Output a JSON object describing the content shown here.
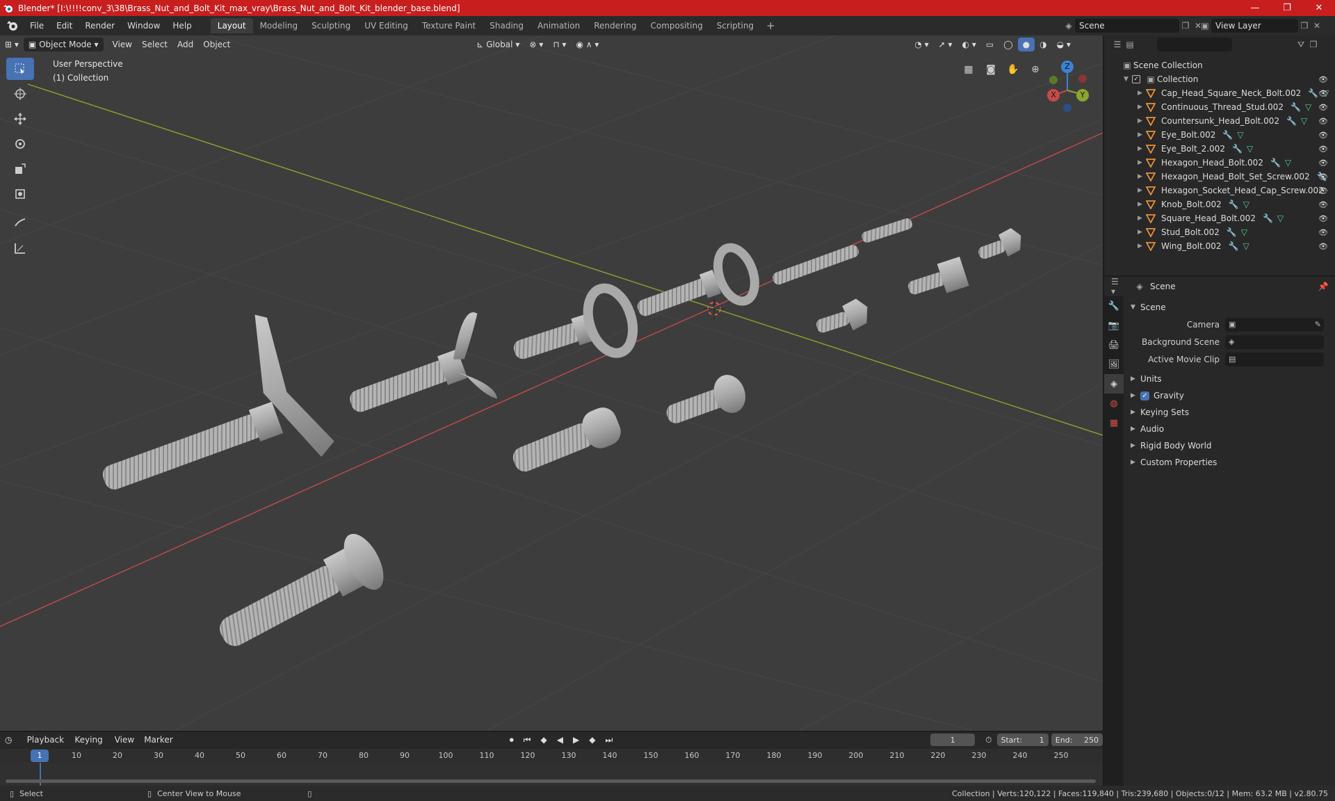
{
  "window": {
    "title": "Blender* [I:\\!!!!conv_3\\38\\Brass_Nut_and_Bolt_Kit_max_vray\\Brass_Nut_and_Bolt_Kit_blender_base.blend]",
    "controls": [
      "—",
      "❐",
      "✕"
    ]
  },
  "menubar": {
    "items": [
      "File",
      "Edit",
      "Render",
      "Window",
      "Help"
    ],
    "workspaces": [
      "Layout",
      "Modeling",
      "Sculpting",
      "UV Editing",
      "Texture Paint",
      "Shading",
      "Animation",
      "Rendering",
      "Compositing",
      "Scripting"
    ],
    "add_workspace": "+",
    "scene": "Scene",
    "view_layer": "View Layer"
  },
  "viewport": {
    "mode": "Object Mode",
    "menus": [
      "View",
      "Select",
      "Add",
      "Object"
    ],
    "orientation": "Global",
    "perspective_label": "User Perspective",
    "collection_label": "(1) Collection",
    "gizmo_axes": {
      "z": "Z",
      "y": "Y",
      "x": "X"
    }
  },
  "outliner": {
    "scene_collection": "Scene Collection",
    "collection": "Collection",
    "objects": [
      {
        "name": "Cap_Head_Square_Neck_Bolt.002"
      },
      {
        "name": "Continuous_Thread_Stud.002"
      },
      {
        "name": "Countersunk_Head_Bolt.002"
      },
      {
        "name": "Eye_Bolt.002"
      },
      {
        "name": "Eye_Bolt_2.002"
      },
      {
        "name": "Hexagon_Head_Bolt.002"
      },
      {
        "name": "Hexagon_Head_Bolt_Set_Screw.002"
      },
      {
        "name": "Hexagon_Socket_Head_Cap_Screw.002"
      },
      {
        "name": "Knob_Bolt.002"
      },
      {
        "name": "Square_Head_Bolt.002"
      },
      {
        "name": "Stud_Bolt.002"
      },
      {
        "name": "Wing_Bolt.002"
      }
    ]
  },
  "properties": {
    "context": "Scene",
    "panel": "Scene",
    "fields": {
      "camera_label": "Camera",
      "background_scene_label": "Background Scene",
      "active_movie_clip_label": "Active Movie Clip"
    },
    "subpanels": [
      "Units",
      "Gravity",
      "Keying Sets",
      "Audio",
      "Rigid Body World",
      "Custom Properties"
    ]
  },
  "timeline": {
    "menus": [
      "Playback",
      "Keying",
      "View",
      "Marker"
    ],
    "current_frame": "1",
    "start_label": "Start:",
    "start": "1",
    "end_label": "End:",
    "end": "250",
    "ruler": [
      "10",
      "20",
      "30",
      "40",
      "50",
      "60",
      "70",
      "80",
      "90",
      "100",
      "110",
      "120",
      "130",
      "140",
      "150",
      "160",
      "170",
      "180",
      "190",
      "200",
      "210",
      "220",
      "230",
      "240",
      "250"
    ],
    "ruler_current": "1"
  },
  "statusbar": {
    "select": "Select",
    "center_view": "Center View to Mouse",
    "stats": "Collection | Verts:120,122 | Faces:119,840 | Tris:239,680 | Objects:0/12 | Mem: 63.2 MB | v2.80.75"
  },
  "colors": {
    "title_bar": "#c81e1e",
    "accent": "#4772b3",
    "viewport_bg": "#3d3d3d",
    "x_axis": "#c54a4a",
    "y_axis": "#8aa62e",
    "z_axis": "#3b82d6",
    "object_icon": "#e8913a"
  }
}
